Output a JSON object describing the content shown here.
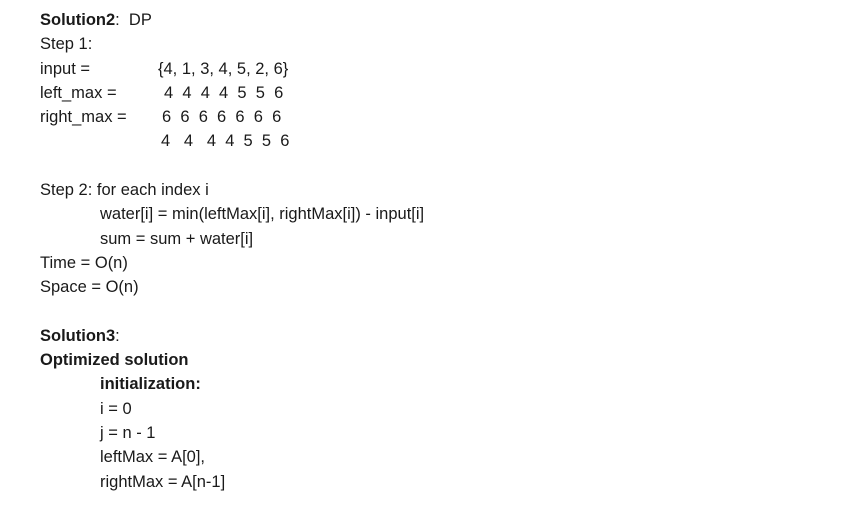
{
  "solution2": {
    "heading_bold": "Solution2",
    "heading_rest": ":  DP",
    "step1_label": "Step 1:",
    "rows": [
      {
        "label": "input =",
        "values": "{4, 1, 3, 4, 5, 2, 6}"
      },
      {
        "label": "left_max =",
        "values": "4  4  4  4  5  5  6"
      },
      {
        "label": "right_max =",
        "values": "6  6  6  6  6  6  6"
      }
    ],
    "extra_row": "4   4   4  4  5  5  6",
    "step2_label": "Step 2: for each index i",
    "step2_lines": [
      "water[i] = min(leftMax[i], rightMax[i]) - input[i]",
      "sum = sum + water[i]"
    ],
    "time": "Time = O(n)",
    "space": "Space = O(n)"
  },
  "solution3": {
    "heading_bold": "Solution3",
    "heading_rest": ":",
    "subheading": "Optimized solution",
    "init_label": "initialization:",
    "init_lines": [
      "i = 0",
      "j = n - 1",
      "leftMax = A[0],",
      "rightMax = A[n-1]"
    ]
  }
}
